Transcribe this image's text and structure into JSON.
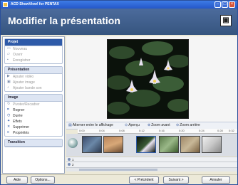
{
  "window": {
    "title": "ACD ShowView! for PENTAX"
  },
  "header": {
    "title": "Modifier la présentation",
    "icon": "slideshow-icon"
  },
  "sidebar": {
    "groups": [
      {
        "title": "Projet",
        "active": true,
        "items": [
          {
            "label": "Nouveau",
            "icon": "new-icon",
            "enabled": false
          },
          {
            "label": "Ouvrir",
            "icon": "open-icon",
            "enabled": false
          },
          {
            "label": "Enregistrer",
            "icon": "save-icon",
            "enabled": false
          }
        ]
      },
      {
        "title": "Présentation",
        "active": false,
        "items": [
          {
            "label": "Ajouter vidéo",
            "icon": "video-icon",
            "enabled": false
          },
          {
            "label": "Ajouter image",
            "icon": "image-icon",
            "enabled": false
          },
          {
            "label": "Ajouter bande son",
            "icon": "audio-icon",
            "enabled": false
          }
        ]
      },
      {
        "title": "Image",
        "active": false,
        "items": [
          {
            "label": "Pivoter/Recadrer",
            "icon": "rotate-icon",
            "enabled": false
          },
          {
            "label": "Rogner",
            "icon": "crop-icon",
            "enabled": true
          },
          {
            "label": "Durée",
            "icon": "duration-icon",
            "enabled": true
          },
          {
            "label": "Effets",
            "icon": "effects-icon",
            "enabled": true
          },
          {
            "label": "Supprimer",
            "icon": "delete-icon",
            "enabled": true
          },
          {
            "label": "Propriétés",
            "icon": "properties-icon",
            "enabled": true
          }
        ]
      },
      {
        "title": "Transition",
        "active": false,
        "items": []
      }
    ]
  },
  "timeline": {
    "toolbar": [
      {
        "label": "Alterner entre le affichage",
        "icon": "toggle-view-icon"
      },
      {
        "label": "Aperçu",
        "icon": "preview-icon"
      },
      {
        "label": "Zoom avant",
        "icon": "zoom-in-icon"
      },
      {
        "label": "Zoom arrière",
        "icon": "zoom-out-icon"
      }
    ],
    "ruler": [
      "0:00",
      "0:04",
      "0:08",
      "0:12",
      "0:16",
      "0:20",
      "0:24",
      "0:28",
      "0:32"
    ],
    "rows": [
      "1",
      "2"
    ]
  },
  "footer": {
    "help": "Aide",
    "options": "Options...",
    "previous": "< Précédent",
    "next": "Suivant >",
    "finish": "Annuler"
  },
  "colors": {
    "header": "#3f5f8f",
    "titlebar": "#2457c8",
    "active_group": "#2e5aa8"
  }
}
